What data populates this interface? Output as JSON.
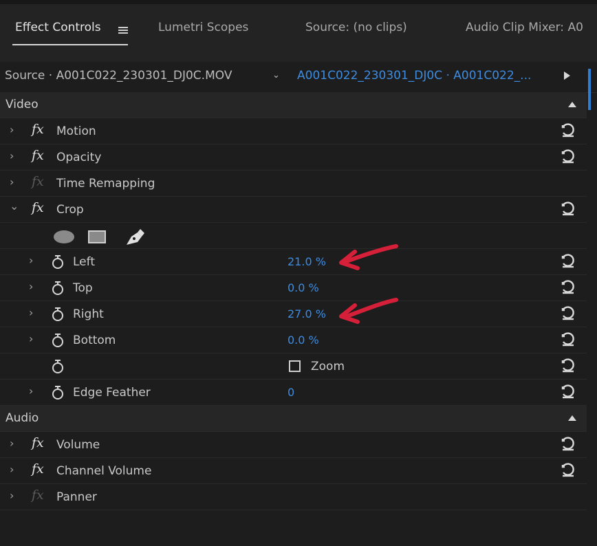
{
  "tabs": [
    {
      "label": "Effect Controls",
      "active": true
    },
    {
      "label": "Lumetri Scopes",
      "active": false
    },
    {
      "label": "Source: (no clips)",
      "active": false
    },
    {
      "label": "Audio Clip Mixer: A0",
      "active": false
    }
  ],
  "source": {
    "left_label": "Source · A001C022_230301_DJ0C.MOV",
    "right_label": "A001C022_230301_DJ0C · A001C022_..."
  },
  "video": {
    "title": "Video",
    "effects": {
      "motion": "Motion",
      "opacity": "Opacity",
      "time_remapping": "Time Remapping",
      "crop": "Crop"
    },
    "crop": {
      "left": {
        "label": "Left",
        "value": "21.0 %"
      },
      "top": {
        "label": "Top",
        "value": "0.0 %"
      },
      "right": {
        "label": "Right",
        "value": "27.0 %"
      },
      "bottom": {
        "label": "Bottom",
        "value": "0.0 %"
      },
      "zoom_label": "Zoom",
      "zoom_checked": false,
      "edge_feather": {
        "label": "Edge Feather",
        "value": "0"
      }
    }
  },
  "audio": {
    "title": "Audio",
    "effects": {
      "volume": "Volume",
      "channel_volume": "Channel Volume",
      "panner": "Panner"
    }
  },
  "colors": {
    "accent_blue": "#3d8ce0",
    "annotation_red": "#d6203a",
    "panel_bg": "#1d1d1d"
  },
  "icons": {
    "fx": "fx-icon",
    "stopwatch": "stopwatch-icon",
    "reset": "reset-icon",
    "ellipse_mask": "ellipse-mask-icon",
    "rectangle_mask": "rectangle-mask-icon",
    "pen_mask": "pen-mask-icon"
  }
}
